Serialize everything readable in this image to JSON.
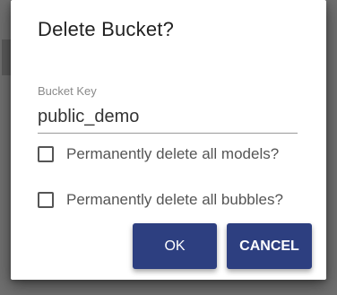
{
  "dialog": {
    "title": "Delete Bucket?",
    "bucket_key": {
      "label": "Bucket Key",
      "value": "public_demo"
    },
    "options": [
      {
        "label": "Permanently delete all models?",
        "checked": false
      },
      {
        "label": "Permanently delete all bubbles?",
        "checked": false
      }
    ],
    "buttons": {
      "ok_label": "OK",
      "cancel_label": "CANCEL"
    }
  },
  "colors": {
    "button_bg": "#2d3f80",
    "backdrop": "#6f6f6f"
  }
}
